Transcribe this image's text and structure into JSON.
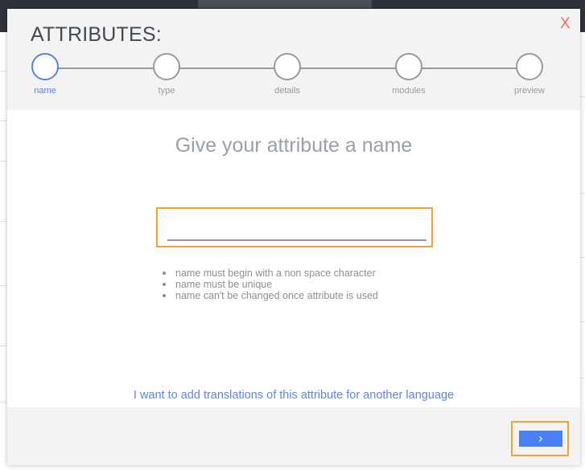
{
  "modal": {
    "title": "ATTRIBUTES:",
    "close_label": "X",
    "steps": [
      {
        "label": "name",
        "active": true
      },
      {
        "label": "type",
        "active": false
      },
      {
        "label": "details",
        "active": false
      },
      {
        "label": "modules",
        "active": false
      },
      {
        "label": "preview",
        "active": false
      }
    ],
    "heading": "Give your attribute a name",
    "name_input": {
      "value": "",
      "placeholder": ""
    },
    "rules": [
      "name must begin with a non space character",
      "name must be unique",
      "name can't be changed once attribute is used"
    ],
    "translation_link": "I want to add translations of this attribute for another language",
    "next_label": "›"
  },
  "colors": {
    "accent": "#5b7fe6",
    "highlight": "#f3a23a",
    "close": "#f26b5a",
    "button": "#4a80f5"
  },
  "icons": {
    "next": "chevron-right-icon",
    "close": "close-icon"
  }
}
